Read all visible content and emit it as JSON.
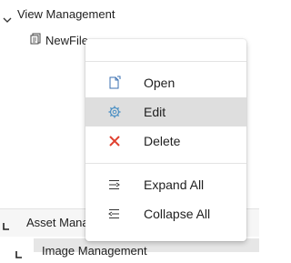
{
  "tree": {
    "root_label": "View Management",
    "child_label": "NewFile"
  },
  "bottom": {
    "asset_label": "Asset Management",
    "image_label": "Image Management"
  },
  "context_menu": {
    "items": [
      {
        "label": "Open",
        "icon": "open-file-icon"
      },
      {
        "label": "Edit",
        "icon": "gear-icon"
      },
      {
        "label": "Delete",
        "icon": "close-x-icon"
      },
      {
        "label": "Expand All",
        "icon": "expand-all-icon"
      },
      {
        "label": "Collapse All",
        "icon": "collapse-all-icon"
      }
    ],
    "highlighted": "Edit",
    "delete_color": "#e0402f"
  }
}
